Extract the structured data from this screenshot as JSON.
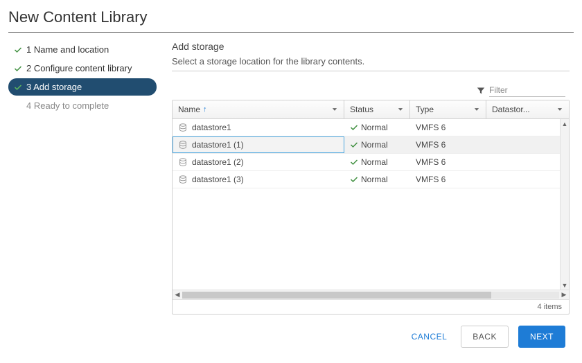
{
  "wizard": {
    "title": "New Content Library",
    "steps": [
      {
        "label": "1 Name and location",
        "state": "done"
      },
      {
        "label": "2 Configure content library",
        "state": "done"
      },
      {
        "label": "3 Add storage",
        "state": "active"
      },
      {
        "label": "4 Ready to complete",
        "state": "future"
      }
    ]
  },
  "main": {
    "heading": "Add storage",
    "description": "Select a storage location for the library contents."
  },
  "filter": {
    "placeholder": "Filter"
  },
  "grid": {
    "columns": {
      "name": "Name",
      "status": "Status",
      "type": "Type",
      "datastore": "Datastor..."
    },
    "rows": [
      {
        "name": "datastore1",
        "status": "Normal",
        "type": "VMFS 6",
        "selected": false
      },
      {
        "name": "datastore1 (1)",
        "status": "Normal",
        "type": "VMFS 6",
        "selected": true
      },
      {
        "name": "datastore1 (2)",
        "status": "Normal",
        "type": "VMFS 6",
        "selected": false
      },
      {
        "name": "datastore1 (3)",
        "status": "Normal",
        "type": "VMFS 6",
        "selected": false
      }
    ],
    "footer": "4 items"
  },
  "buttons": {
    "cancel": "CANCEL",
    "back": "BACK",
    "next": "NEXT"
  }
}
